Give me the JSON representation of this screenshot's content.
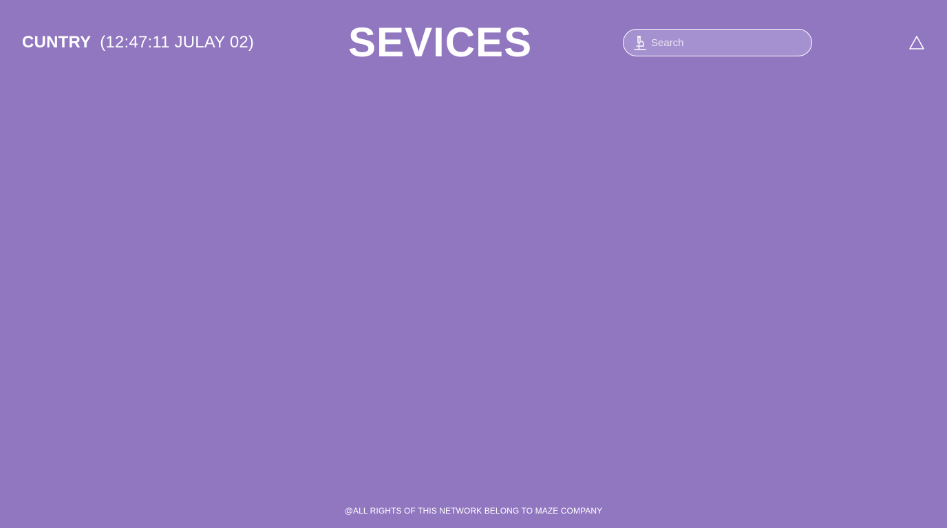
{
  "header": {
    "country_name": "CUNTRY",
    "datetime": "(12:47:11 JULAY 02)",
    "title": "SEVICES",
    "search": {
      "placeholder": "Search",
      "value": "",
      "icon": "microscope-icon"
    },
    "alert_icon": "triangle-alert-icon"
  },
  "footer": {
    "text": "@ALL RIGHTS OF THIS NETWORK BELONG TO MAZE COMPANY"
  },
  "colors": {
    "background": "#9177c0",
    "search_background": "#a591cf",
    "text": "#ffffff"
  }
}
